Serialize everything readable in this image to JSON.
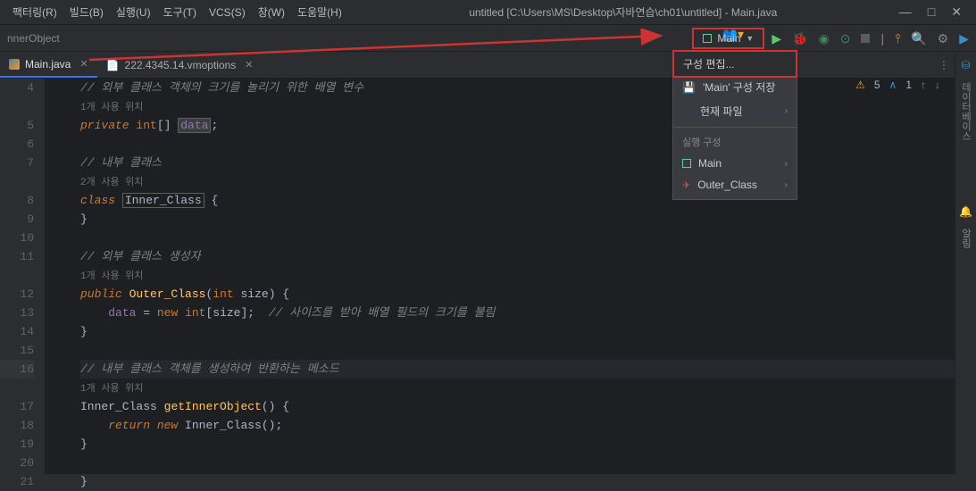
{
  "menu": {
    "refactor": "팩터링(R)",
    "build": "빌드(B)",
    "run": "실행(U)",
    "tools": "도구(T)",
    "vcs": "VCS(S)",
    "window": "창(W)",
    "help": "도움말(H)"
  },
  "title": "untitled [C:\\Users\\MS\\Desktop\\자바연습\\ch01\\untitled] - Main.java",
  "breadcrumb": "nnerObject",
  "runConfig": {
    "selected": "Main"
  },
  "tabs": [
    {
      "label": "Main.java",
      "active": true
    },
    {
      "label": "222.4345.14.vmoptions",
      "active": false
    }
  ],
  "dropdown": {
    "editConfig": "구성 편집...",
    "saveConfig": "'Main' 구성 저장",
    "currentFile": "현재 파일",
    "runConfigHeader": "실행 구성",
    "main": "Main",
    "outerClass": "Outer_Class"
  },
  "status": {
    "warnings": "5",
    "weakWarnings": "1"
  },
  "sidebar": {
    "notifications": "알림",
    "database": "데이터베이스"
  },
  "gutter": {
    "lines": [
      "4",
      "",
      "5",
      "6",
      "7",
      "",
      "8",
      "9",
      "10",
      "11",
      "",
      "12",
      "13",
      "14",
      "15",
      "16",
      "",
      "17",
      "18",
      "19",
      "20",
      "21"
    ]
  },
  "code": {
    "l4": "// 외부 클래스 객체의 크기를 놀리기 위한 배열 변수",
    "l4u": "1개 사용 위치",
    "l5_kw": "private",
    "l5_type": "int",
    "l5_field": "data",
    "l7": "// 내부 클래스",
    "l7u": "2개 사용 위치",
    "l8_kw": "class",
    "l8_name": "Inner_Class",
    "l11": "// 외부 클래스 생성자",
    "l11u": "1개 사용 위치",
    "l12_kw": "public",
    "l12_name": "Outer_Class",
    "l12_type": "int",
    "l12_param": "size",
    "l13_field": "data",
    "l13_kw": "new",
    "l13_type": "int",
    "l13_param": "size",
    "l13_comment": "// 사이즈를 받아 배열 필드의 크기를 불림",
    "l16": "// 내부 클래스 객체를 생성하여 반환하는 메소드",
    "l16u": "1개 사용 위치",
    "l17_type": "Inner_Class",
    "l17_method": "getInnerObject",
    "l18_kw": "return new",
    "l18_name": "Inner_Class"
  }
}
